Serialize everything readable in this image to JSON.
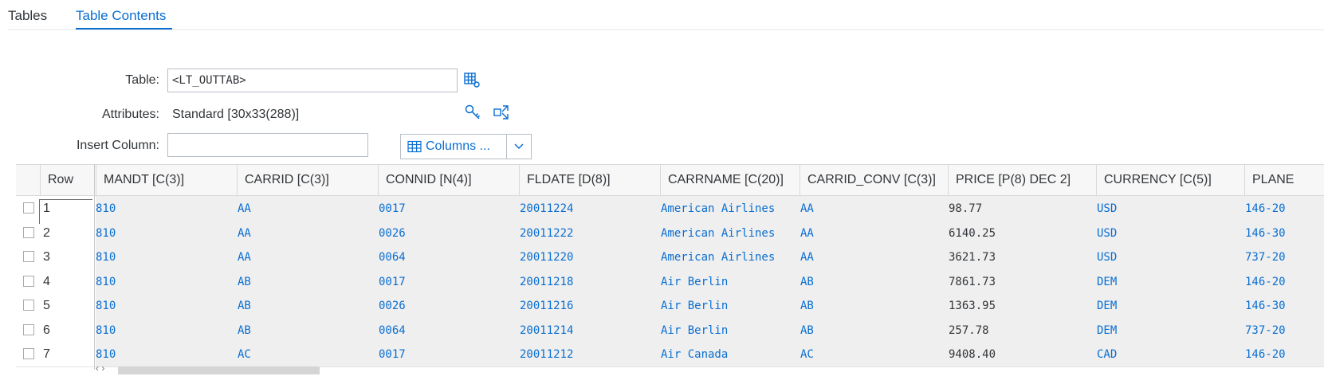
{
  "tabs": [
    {
      "label": "Tables"
    },
    {
      "label": "Table Contents"
    }
  ],
  "form": {
    "table_label": "Table:",
    "table_value": "<LT_OUTTAB>",
    "attributes_label": "Attributes:",
    "attributes_value": "Standard [30x33(288)]",
    "insert_column_label": "Insert Column:",
    "insert_column_value": "",
    "columns_button_label": "Columns ..."
  },
  "accent_color": "#0a6ed1",
  "icons": [
    "table-settings-icon",
    "key-icon",
    "expand-icon",
    "columns-icon",
    "chevron-down-icon"
  ],
  "grid": {
    "row_header": "Row",
    "columns": [
      "MANDT [C(3)]",
      "CARRID [C(3)]",
      "CONNID [N(4)]",
      "FLDATE [D(8)]",
      "CARRNAME [C(20)]",
      "CARRID_CONV [C(3)]",
      "PRICE [P(8) DEC 2]",
      "CURRENCY [C(5)]",
      "PLANE"
    ],
    "rows": [
      {
        "num": "1",
        "cells": [
          "810",
          "AA",
          "0017",
          "20011224",
          "American Airlines",
          "AA",
          "98.77",
          "USD",
          "146-20"
        ]
      },
      {
        "num": "2",
        "cells": [
          "810",
          "AA",
          "0026",
          "20011222",
          "American Airlines",
          "AA",
          "6140.25",
          "USD",
          "146-30"
        ]
      },
      {
        "num": "3",
        "cells": [
          "810",
          "AA",
          "0064",
          "20011220",
          "American Airlines",
          "AA",
          "3621.73",
          "USD",
          "737-20"
        ]
      },
      {
        "num": "4",
        "cells": [
          "810",
          "AB",
          "0017",
          "20011218",
          "Air Berlin",
          "AB",
          "7861.73",
          "DEM",
          "146-20"
        ]
      },
      {
        "num": "5",
        "cells": [
          "810",
          "AB",
          "0026",
          "20011216",
          "Air Berlin",
          "AB",
          "1363.95",
          "DEM",
          "146-30"
        ]
      },
      {
        "num": "6",
        "cells": [
          "810",
          "AB",
          "0064",
          "20011214",
          "Air Berlin",
          "AB",
          "257.78",
          "DEM",
          "737-20"
        ]
      },
      {
        "num": "7",
        "cells": [
          "810",
          "AC",
          "0017",
          "20011212",
          "Air Canada",
          "AC",
          "9408.40",
          "CAD",
          "146-20"
        ]
      }
    ]
  }
}
